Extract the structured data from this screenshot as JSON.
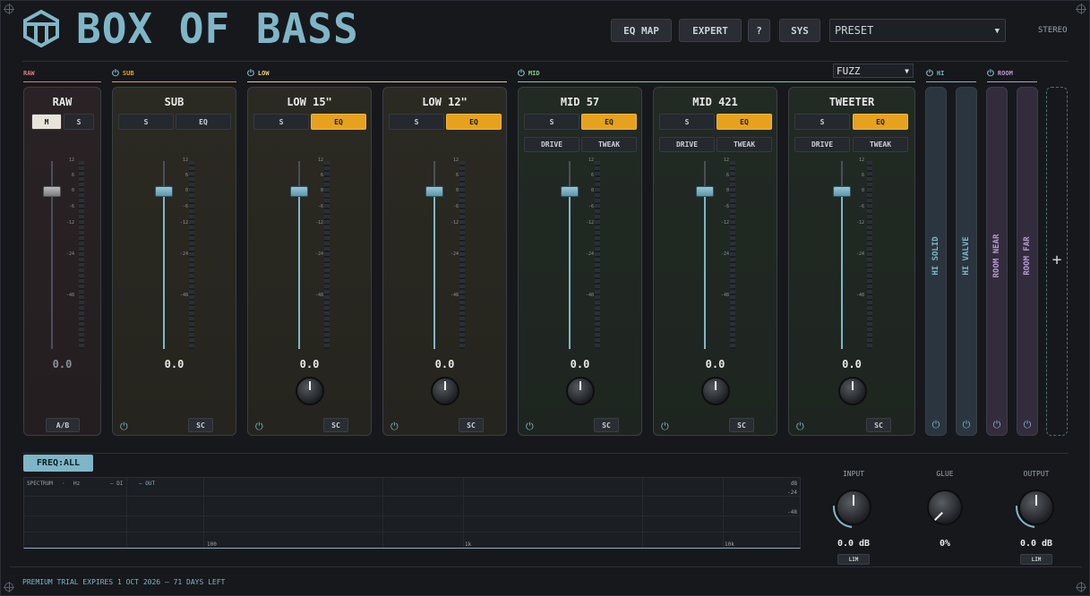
{
  "header": {
    "title": "BOX OF BASS",
    "buttons": [
      "EQ MAP",
      "EXPERT",
      "?",
      "SYS"
    ],
    "preset": "PRESET",
    "mode": "STEREO"
  },
  "groups": {
    "raw": "RAW",
    "sub": "SUB",
    "low": "LOW",
    "mid": "MID",
    "hi": "HI",
    "room": "ROOM",
    "mid_select": "FUZZ"
  },
  "channels": [
    {
      "name": "RAW",
      "btn1": "M",
      "btn2": "S",
      "value": "0.0",
      "foot": "A/B"
    },
    {
      "name": "SUB",
      "btn1": "S",
      "btn2": "EQ",
      "value": "0.0",
      "foot": "SC"
    },
    {
      "name": "LOW 15\"",
      "btn1": "S",
      "btn2": "EQ",
      "value": "0.0",
      "foot": "SC"
    },
    {
      "name": "LOW 12\"",
      "btn1": "S",
      "btn2": "EQ",
      "value": "0.0",
      "foot": "SC"
    },
    {
      "name": "MID 57",
      "btn1": "S",
      "btn2": "EQ",
      "drive": "DRIVE",
      "tweak": "TWEAK",
      "value": "0.0",
      "foot": "SC"
    },
    {
      "name": "MID 421",
      "btn1": "S",
      "btn2": "EQ",
      "drive": "DRIVE",
      "tweak": "TWEAK",
      "value": "0.0",
      "foot": "SC"
    },
    {
      "name": "TWEETER",
      "btn1": "S",
      "btn2": "EQ",
      "drive": "DRIVE",
      "tweak": "TWEAK",
      "value": "0.0",
      "foot": "SC"
    }
  ],
  "scale_ticks": [
    "12",
    "6",
    "0",
    "-6",
    "-12",
    "-24",
    "-48"
  ],
  "slots": [
    "HI SOLID",
    "HI VALVE",
    "ROOM NEAR",
    "ROOM FAR"
  ],
  "add_slot": "+",
  "spectrum": {
    "button": "FREQ:ALL",
    "label": "SPECTRUM",
    "unit": "Hz",
    "legend_di": "— DI",
    "legend_out": "— OUT",
    "db_top": "dB",
    "db_mid": "-24",
    "db_low": "-48",
    "freq_100": "100",
    "freq_1k": "1k",
    "freq_10k": "10k"
  },
  "master": {
    "input_label": "INPUT",
    "input_value": "0.0 dB",
    "glue_label": "GLUE",
    "glue_value": "0%",
    "output_label": "OUTPUT",
    "output_value": "0.0 dB",
    "lim": "LIM"
  },
  "footer": {
    "trial": "PREMIUM TRIAL EXPIRES 1 OCT 2026 — 71 DAYS LEFT"
  },
  "colors": {
    "accent": "#7fb6c7",
    "active": "#e6a21f",
    "sub_group": "#e6a21f",
    "low_group": "#e6d070",
    "mid_group": "#7fcf8a",
    "hi_group": "#7fb6c7",
    "room_group": "#b69ad0",
    "raw_group": "#e27a7a"
  }
}
